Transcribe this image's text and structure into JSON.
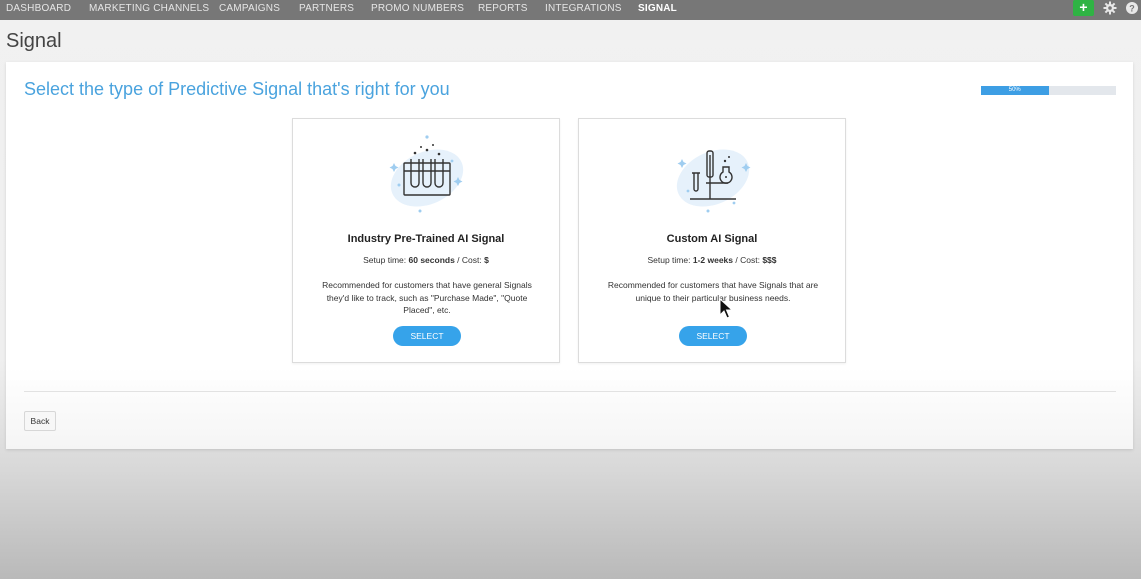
{
  "nav": {
    "items": [
      "DASHBOARD",
      "MARKETING CHANNELS",
      "CAMPAIGNS",
      "PARTNERS",
      "PROMO NUMBERS",
      "REPORTS",
      "INTEGRATIONS",
      "SIGNAL"
    ],
    "active": "SIGNAL",
    "add_label": "+"
  },
  "page": {
    "title": "Signal"
  },
  "panel": {
    "heading": "Select the type of Predictive Signal that's right for you",
    "progress": {
      "label": "50%",
      "value": 0.5
    },
    "back_label": "Back"
  },
  "cards": [
    {
      "title": "Industry Pre-Trained AI Signal",
      "setup_prefix": "Setup time: ",
      "setup_time": "60 seconds",
      "cost_prefix": " / Cost: ",
      "cost": "$",
      "description": "Recommended for customers that have general Signals they'd like to track, such as \"Purchase Made\", \"Quote Placed\", etc.",
      "button": "SELECT",
      "icon": "test-tubes-icon"
    },
    {
      "title": "Custom AI Signal",
      "setup_prefix": "Setup time: ",
      "setup_time": "1-2 weeks",
      "cost_prefix": " / Cost: ",
      "cost": "$$$",
      "description": "Recommended for customers that have Signals that are unique to their particular business needs.",
      "button": "SELECT",
      "icon": "lab-flask-stand-icon"
    }
  ],
  "colors": {
    "nav_bg": "#777777",
    "accent_blue": "#36a3ea",
    "heading_blue": "#4aa3de",
    "add_green": "#2fb344"
  }
}
